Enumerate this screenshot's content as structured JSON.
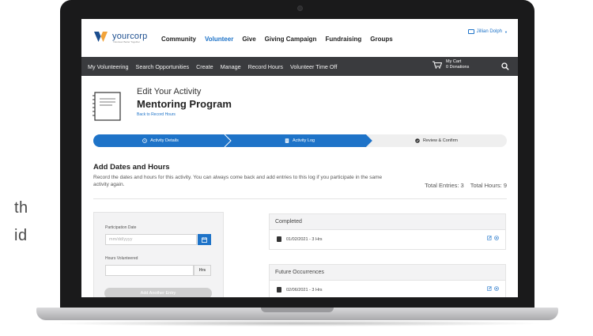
{
  "background_text": [
    "th",
    "id"
  ],
  "app": {
    "brand": "yourcorp",
    "brand_tagline": "Volunteer Better Together"
  },
  "topnav": {
    "items": [
      "Community",
      "Volunteer",
      "Give",
      "Giving Campaign",
      "Fundraising",
      "Groups"
    ],
    "active": "Volunteer",
    "user_name": "Jillian Dolph"
  },
  "subnav": {
    "items": [
      "My Volunteering",
      "Search Opportunities",
      "Create",
      "Manage",
      "Record Hours",
      "Volunteer Time Off"
    ],
    "cart_title": "My Cart",
    "cart_count": "0 Donations"
  },
  "header": {
    "edit_label": "Edit Your Activity",
    "program_title": "Mentoring Program",
    "back_link": "Back to Record Hours"
  },
  "steps": [
    {
      "label": "Activity Details",
      "icon": "clock-icon",
      "state": "complete"
    },
    {
      "label": "Activity Log",
      "icon": "log-icon",
      "state": "active"
    },
    {
      "label": "Review & Confirm",
      "icon": "check-circle-icon",
      "state": "pending"
    }
  ],
  "section": {
    "title": "Add Dates and Hours",
    "description": "Record the dates and hours for this activity. You can always come back and add entries to this log if you participate in the same activity again.",
    "total_entries": "Total Entries: 3",
    "total_hours": "Total Hours: 9"
  },
  "form": {
    "date_label": "Participation Date",
    "date_placeholder": "mm/dd/yyyy",
    "hours_label": "Hours Volunteered",
    "hours_unit": "Hrs",
    "add_button": "Add Another Entry"
  },
  "log": {
    "completed_header": "Completed",
    "completed_entries": [
      "01/02/2021 - 3 Hrs"
    ],
    "future_header": "Future Occurrences",
    "future_entries": [
      "02/06/2021 - 3 Hrs"
    ]
  },
  "colors": {
    "primary": "#1e73c8",
    "brand": "#1c4e8f",
    "subnav_bg": "#3a3b3e",
    "step_pending_bg": "#efefef"
  }
}
